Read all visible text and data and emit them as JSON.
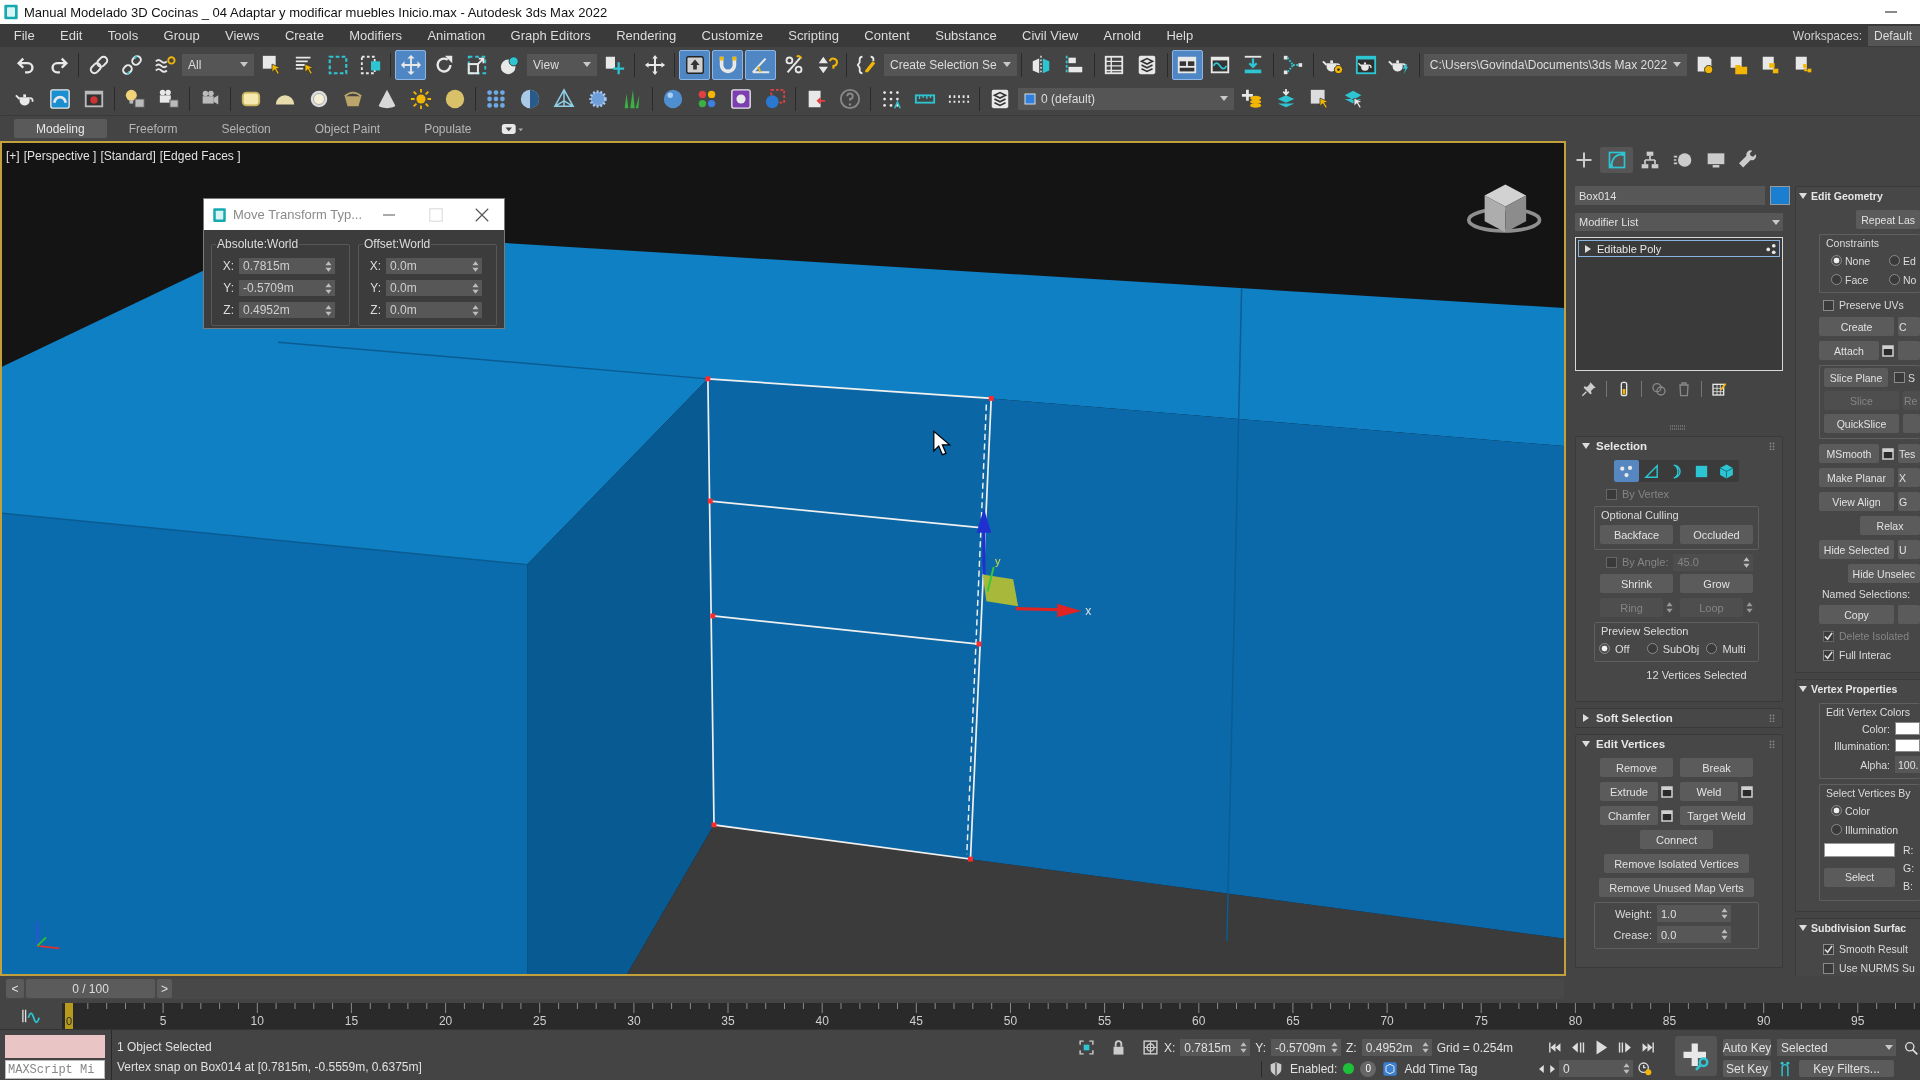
{
  "window": {
    "title": "Manual Modelado 3D Cocinas _ 04 Adaptar y modificar muebles Inicio.max - Autodesk 3ds Max 2022"
  },
  "menu": {
    "items": [
      "File",
      "Edit",
      "Tools",
      "Group",
      "Views",
      "Create",
      "Modifiers",
      "Animation",
      "Graph Editors",
      "Rendering",
      "Customize",
      "Scripting",
      "Content",
      "Substance",
      "Civil View",
      "Arnold",
      "Help"
    ],
    "workspaces_label": "Workspaces:",
    "workspace": "Default"
  },
  "toolbar_1": [
    {
      "kind": "button",
      "selected": false
    },
    {
      "kind": "button",
      "selected": false
    },
    {
      "kind": "separator"
    },
    {
      "kind": "button",
      "selected": false
    },
    {
      "kind": "button",
      "selected": false
    },
    {
      "kind": "button",
      "selected": false
    },
    {
      "kind": "dropdown",
      "value": "All"
    },
    {
      "kind": "button",
      "selected": false
    },
    {
      "kind": "button",
      "selected": false
    },
    {
      "kind": "button",
      "selected": false
    },
    {
      "kind": "button",
      "selected": false
    },
    {
      "kind": "separator"
    },
    {
      "kind": "button",
      "selected": true
    },
    {
      "kind": "button",
      "selected": false
    },
    {
      "kind": "button",
      "selected": false
    },
    {
      "kind": "button",
      "selected": false
    },
    {
      "kind": "dropdown",
      "value": "View"
    },
    {
      "kind": "button",
      "selected": false
    },
    {
      "kind": "separator"
    },
    {
      "kind": "button",
      "selected": false
    },
    {
      "kind": "separator"
    },
    {
      "kind": "button",
      "selected": true
    },
    {
      "kind": "button",
      "selected": true
    },
    {
      "kind": "button",
      "selected": true
    },
    {
      "kind": "button",
      "selected": false
    },
    {
      "kind": "button",
      "selected": false
    },
    {
      "kind": "separator"
    },
    {
      "kind": "button",
      "selected": false
    },
    {
      "kind": "dropdown",
      "value": "Create Selection Se"
    },
    {
      "kind": "separator"
    },
    {
      "kind": "button",
      "selected": false
    },
    {
      "kind": "button",
      "selected": false
    },
    {
      "kind": "separator"
    },
    {
      "kind": "button",
      "selected": false
    },
    {
      "kind": "button",
      "selected": false
    },
    {
      "kind": "separator"
    },
    {
      "kind": "button",
      "selected": true
    },
    {
      "kind": "button",
      "selected": false
    },
    {
      "kind": "button",
      "selected": false
    },
    {
      "kind": "separator"
    },
    {
      "kind": "button",
      "selected": false
    },
    {
      "kind": "separator"
    },
    {
      "kind": "button",
      "selected": false
    },
    {
      "kind": "button",
      "selected": false
    },
    {
      "kind": "button",
      "selected": false
    },
    {
      "kind": "separator"
    },
    {
      "kind": "dropdown",
      "value": "C:\\Users\\Govinda\\Documents\\3ds Max 2022"
    },
    {
      "kind": "button",
      "selected": false
    },
    {
      "kind": "button",
      "selected": false
    },
    {
      "kind": "button",
      "selected": false
    },
    {
      "kind": "button",
      "selected": false
    }
  ],
  "toolbar_2": [
    {
      "kind": "button"
    },
    {
      "kind": "button"
    },
    {
      "kind": "button"
    },
    {
      "kind": "separator"
    },
    {
      "kind": "button"
    },
    {
      "kind": "button"
    },
    {
      "kind": "separator"
    },
    {
      "kind": "button"
    },
    {
      "kind": "separator"
    },
    {
      "kind": "button"
    },
    {
      "kind": "button"
    },
    {
      "kind": "button"
    },
    {
      "kind": "button"
    },
    {
      "kind": "button"
    },
    {
      "kind": "button"
    },
    {
      "kind": "button"
    },
    {
      "kind": "separator"
    },
    {
      "kind": "button"
    },
    {
      "kind": "button"
    },
    {
      "kind": "button"
    },
    {
      "kind": "button"
    },
    {
      "kind": "button"
    },
    {
      "kind": "separator"
    },
    {
      "kind": "button"
    },
    {
      "kind": "button"
    },
    {
      "kind": "button"
    },
    {
      "kind": "button"
    },
    {
      "kind": "separator"
    },
    {
      "kind": "button"
    },
    {
      "kind": "button"
    },
    {
      "kind": "separator"
    },
    {
      "kind": "button"
    },
    {
      "kind": "button"
    },
    {
      "kind": "button"
    },
    {
      "kind": "separator"
    },
    {
      "kind": "button"
    },
    {
      "kind": "dropdown",
      "value": "0 (default)"
    },
    {
      "kind": "button"
    },
    {
      "kind": "button"
    },
    {
      "kind": "button"
    },
    {
      "kind": "button"
    }
  ],
  "ribbon": {
    "tabs": [
      {
        "label": "Modeling",
        "selected": true
      },
      {
        "label": "Freeform",
        "selected": false
      },
      {
        "label": "Selection",
        "selected": false
      },
      {
        "label": "Object Paint",
        "selected": false
      },
      {
        "label": "Populate",
        "selected": false
      }
    ]
  },
  "viewport": {
    "labels": [
      "[+]",
      "[Perspective ]",
      "[Standard]",
      "[Edged Faces ]"
    ],
    "gizmo_labels": [
      "x",
      "y"
    ]
  },
  "transform_dialog": {
    "title": "Move Transform Typ...",
    "groups": [
      {
        "label": "Absolute:World",
        "fields": [
          {
            "axis": "X:",
            "value": "0.7815m"
          },
          {
            "axis": "Y:",
            "value": "-0.5709m"
          },
          {
            "axis": "Z:",
            "value": "0.4952m"
          }
        ]
      },
      {
        "label": "Offset:World",
        "fields": [
          {
            "axis": "X:",
            "value": "0.0m"
          },
          {
            "axis": "Y:",
            "value": "0.0m"
          },
          {
            "axis": "Z:",
            "value": "0.0m"
          }
        ]
      }
    ]
  },
  "command_panel": {
    "tabs": [
      {
        "selected": false
      },
      {
        "selected": true
      },
      {
        "selected": false
      },
      {
        "selected": false
      },
      {
        "selected": false
      },
      {
        "selected": false
      }
    ],
    "object": {
      "name": "Box014",
      "color": "#1a7fd0"
    },
    "modifier_list": "Modifier List",
    "stack": [
      {
        "label": "Editable Poly",
        "expanded": false,
        "selected": true
      }
    ],
    "left": [
      {
        "title": "Selection",
        "expanded": true,
        "rows": [
          {
            "kind": "subobjects",
            "items": [
              {
                "selected": true
              },
              {
                "selected": false
              },
              {
                "selected": false
              },
              {
                "selected": false
              },
              {
                "selected": false
              }
            ]
          },
          {
            "kind": "checkbox",
            "label": "By Vertex",
            "checked": false,
            "disabled": true
          },
          {
            "kind": "group",
            "title": "Optional Culling",
            "rows": [
              {
                "kind": "buttons",
                "items": [
                  {
                    "label": "Backface"
                  },
                  {
                    "label": "Occluded"
                  }
                ]
              }
            ]
          },
          {
            "kind": "checkspinner",
            "label": "By Angle:",
            "checked": false,
            "disabled": true,
            "value": "45.0"
          },
          {
            "kind": "buttons",
            "items": [
              {
                "label": "Shrink"
              },
              {
                "label": "Grow"
              }
            ]
          },
          {
            "kind": "buttons",
            "items": [
              {
                "label": "Ring",
                "disabled": true,
                "spinner": true
              },
              {
                "label": "Loop",
                "disabled": true,
                "spinner": true
              }
            ]
          },
          {
            "kind": "group",
            "title": "Preview Selection",
            "rows": [
              {
                "kind": "radios",
                "items": [
                  {
                    "label": "Off",
                    "selected": true
                  },
                  {
                    "label": "SubObj",
                    "selected": false
                  },
                  {
                    "label": "Multi",
                    "selected": false
                  }
                ]
              }
            ]
          },
          {
            "kind": "status",
            "label": "12 Vertices Selected"
          }
        ]
      },
      {
        "title": "Soft Selection",
        "expanded": false
      },
      {
        "title": "Edit Vertices",
        "expanded": true,
        "rows": [
          {
            "kind": "buttons",
            "items": [
              {
                "label": "Remove"
              },
              {
                "label": "Break"
              }
            ]
          },
          {
            "kind": "buttons",
            "items": [
              {
                "label": "Extrude",
                "settings": true
              },
              {
                "label": "Weld",
                "settings": true
              }
            ]
          },
          {
            "kind": "buttons",
            "items": [
              {
                "label": "Chamfer",
                "settings": true
              },
              {
                "label": "Target Weld",
                "settings": false
              }
            ]
          },
          {
            "kind": "buttons",
            "items": [
              {
                "label": "Connect"
              }
            ]
          },
          {
            "kind": "buttons",
            "items": [
              {
                "label": "Remove Isolated Vertices"
              }
            ]
          },
          {
            "kind": "buttons",
            "items": [
              {
                "label": "Remove Unused Map Verts"
              }
            ]
          },
          {
            "kind": "group",
            "rows": [
              {
                "kind": "spinner",
                "label": "Weight:",
                "value": "1.0"
              },
              {
                "kind": "spinner",
                "label": "Crease:",
                "value": "0.0"
              }
            ]
          }
        ]
      }
    ],
    "right": [
      {
        "title": "Edit Geometry",
        "expanded": true,
        "rows": [
          {
            "kind": "buttons",
            "items": [
              {
                "label": "Repeat Las"
              }
            ]
          },
          {
            "kind": "group",
            "title": "Constraints",
            "rows": [
              {
                "kind": "radios",
                "items": [
                  {
                    "label": "None",
                    "selected": true
                  },
                  {
                    "label": "Ed",
                    "selected": false
                  }
                ]
              },
              {
                "kind": "radios",
                "items": [
                  {
                    "label": "Face",
                    "selected": false
                  },
                  {
                    "label": "No",
                    "selected": false
                  }
                ]
              }
            ]
          },
          {
            "kind": "checkbox",
            "label": "Preserve UVs",
            "checked": false,
            "disabled": false
          },
          {
            "kind": "buttons",
            "items": [
              {
                "label": "Create"
              },
              {
                "label": "C"
              }
            ]
          },
          {
            "kind": "buttons",
            "items": [
              {
                "label": "Attach",
                "settings": true
              },
              {
                "settings": false
              }
            ]
          },
          {
            "kind": "group",
            "rows": [
              {
                "kind": "button_check",
                "button": {
                  "label": "Slice Plane"
                },
                "check": {
                  "label": "S",
                  "checked": false
                }
              },
              {
                "kind": "buttons",
                "items": [
                  {
                    "label": "Slice",
                    "disabled": true
                  },
                  {
                    "label": "Re",
                    "disabled": true
                  }
                ]
              },
              {
                "kind": "buttons",
                "items": [
                  {
                    "label": "QuickSlice",
                    "settings": false
                  },
                  {
                    "settings": false
                  }
                ]
              }
            ]
          },
          {
            "kind": "buttons",
            "items": [
              {
                "label": "MSmooth",
                "settings": true
              },
              {
                "label": "Tes",
                "settings": false
              }
            ]
          },
          {
            "kind": "buttons",
            "items": [
              {
                "label": "Make Planar"
              },
              {
                "label": "X"
              }
            ]
          },
          {
            "kind": "buttons",
            "items": [
              {
                "label": "View Align"
              },
              {
                "label": "G"
              }
            ]
          },
          {
            "kind": "buttons",
            "items": [
              {
                "label": "Relax"
              }
            ]
          },
          {
            "kind": "buttons",
            "items": [
              {
                "label": "Hide Selected"
              },
              {
                "label": "U"
              }
            ]
          },
          {
            "kind": "buttons",
            "items": [
              {
                "label": "Hide Unselec"
              }
            ]
          },
          {
            "kind": "label",
            "label": "Named Selections:"
          },
          {
            "kind": "buttons",
            "items": [
              {
                "label": "Copy",
                "settings": false
              },
              {
                "settings": false
              }
            ]
          },
          {
            "kind": "checkbox",
            "label": "Delete Isolated",
            "checked": true,
            "disabled": true
          },
          {
            "kind": "checkbox",
            "label": "Full Interac",
            "checked": true,
            "disabled": false
          }
        ]
      },
      {
        "title": "Vertex Properties",
        "expanded": true,
        "rows": [
          {
            "kind": "group",
            "title": "Edit Vertex Colors",
            "rows": [
              {
                "kind": "swatch",
                "label": "Color:",
                "color": "#ffffff"
              },
              {
                "kind": "swatch",
                "label": "Illumination:",
                "color": "#ffffff"
              },
              {
                "kind": "spinner",
                "label": "Alpha:",
                "value": "100."
              }
            ]
          },
          {
            "kind": "group",
            "title": "Select Vertices By",
            "rows": [
              {
                "kind": "radios",
                "items": [
                  {
                    "label": "Color",
                    "selected": true
                  }
                ]
              },
              {
                "kind": "radios",
                "items": [
                  {
                    "label": "Illumination",
                    "selected": false
                  }
                ]
              },
              {
                "kind": "rgb",
                "color": "#ffffff",
                "labels": [
                  "R:",
                  "G:",
                  "B:"
                ],
                "button": "Select"
              }
            ]
          }
        ]
      },
      {
        "title": "Subdivision Surfac",
        "expanded": true,
        "rows": [
          {
            "kind": "checkbox",
            "label": "Smooth Result",
            "checked": true,
            "disabled": false
          },
          {
            "kind": "checkbox",
            "label": "Use NURMS Su",
            "checked": false,
            "disabled": false
          }
        ]
      }
    ]
  },
  "time_slider": {
    "prev": "<",
    "position": "0 / 100",
    "next": ">",
    "level": 0
  },
  "track_bar": {
    "current_frame": "0",
    "ticks": [
      "5",
      "10",
      "15",
      "20",
      "25",
      "30",
      "35",
      "40",
      "45",
      "50",
      "55",
      "60",
      "65",
      "70",
      "75",
      "80",
      "85",
      "90",
      "95"
    ]
  },
  "status_bar": {
    "listener_placeholder": "MAXScript Mi",
    "messages": [
      "1 Object Selected",
      "Vertex snap on Box014 at [0.7815m, -0.5559m, 0.6375m]"
    ],
    "coords": [
      {
        "axis": "X:",
        "value": "0.7815m"
      },
      {
        "axis": "Y:",
        "value": "-0.5709m"
      },
      {
        "axis": "Z:",
        "value": "0.4952m"
      }
    ],
    "grid": "Grid = 0.254m",
    "time_tag": {
      "label": "Enabled:",
      "enabled": true,
      "count": "0",
      "add": "Add Time Tag"
    },
    "frame": "0",
    "auto_key": "Auto Key",
    "set_key": "Set Key",
    "key_mode": "Selected",
    "key_filters": "Key Filters..."
  }
}
